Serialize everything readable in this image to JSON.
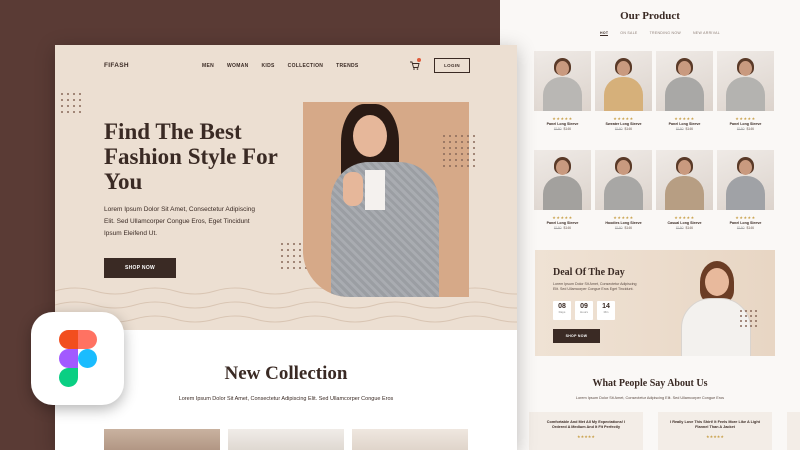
{
  "landing": {
    "brand": "FIFASH",
    "nav": [
      "MEN",
      "WOMAN",
      "KIDS",
      "COLLECTION",
      "TRENDS"
    ],
    "login_label": "LOGIN",
    "hero_title": "Find The Best Fashion Style For You",
    "hero_text": "Lorem Ipsum Dolor Sit Amet, Consectetur Adipiscing Elit. Sed Ullamcorper Congue Eros, Eget Tincidunt Ipsum Eleifend Ut.",
    "shop_label": "SHOP NOW",
    "new_collection_title": "New Collection",
    "new_collection_text": "Lorem Ipsum Dolor Sit Amet, Consectetur Adipiscing Elit. Sed Ullamcorper Congue Eros"
  },
  "products_page": {
    "title": "Our Product",
    "tabs": [
      "HOT",
      "ON SALE",
      "TRENDING NOW",
      "NEW ARRIVAL"
    ],
    "active_tab": "HOT",
    "products": [
      {
        "name": "Panel Long Sleeve",
        "price": "$146",
        "old_price": "$180",
        "stars": "★★★★★",
        "top": "#b9b7b4"
      },
      {
        "name": "Sweater Long Sleeve",
        "price": "$146",
        "old_price": "$180",
        "stars": "★★★★★",
        "top": "#d6b07a"
      },
      {
        "name": "Panel Long Sleeve",
        "price": "$146",
        "old_price": "$180",
        "stars": "★★★★★",
        "top": "#a9a8a6"
      },
      {
        "name": "Panel Long Sleeve",
        "price": "$146",
        "old_price": "$180",
        "stars": "★★★★★",
        "top": "#b4b3b0"
      },
      {
        "name": "Panel Long Sleeve",
        "price": "$146",
        "old_price": "$180",
        "stars": "★★★★★",
        "top": "#a3a19e"
      },
      {
        "name": "Hoodies Long Sleeve",
        "price": "$146",
        "old_price": "$180",
        "stars": "★★★★★",
        "top": "#a8a7a5"
      },
      {
        "name": "Casual Long Sleeve",
        "price": "$146",
        "old_price": "$180",
        "stars": "★★★★★",
        "top": "#b79e83"
      },
      {
        "name": "Panel Long Sleeve",
        "price": "$146",
        "old_price": "$180",
        "stars": "★★★★★",
        "top": "#a0a2a6"
      }
    ],
    "deal": {
      "title": "Deal Of The Day",
      "text": "Lorem Ipsum Dolor Sit Amet, Consectetur Adipiscing Elit. Sed Ullamcorper Congue Eros Eget Tincidunt.",
      "timer": [
        {
          "value": "08",
          "label": "Days"
        },
        {
          "value": "09",
          "label": "Hours"
        },
        {
          "value": "14",
          "label": "Min"
        }
      ],
      "button": "SHOP NOW"
    },
    "testimonials_title": "What People Say About Us",
    "testimonials_text": "Lorem Ipsum Dolor Sit Amet, Consectetur Adipiscing Elit. Sed Ullamcorper Congue Eros",
    "testimonials": [
      {
        "quote": "Comfortable And Met All My Expectations! I Ordered A Medium And It Fit Perfectly",
        "stars": "★★★★★"
      },
      {
        "quote": "I Really Love This Shirt! It Feels More Like A Light Flannel Than A Jacket",
        "stars": "★★★★★"
      }
    ]
  },
  "colors": {
    "background": "#5a3b35",
    "hero": "#ecdfd2",
    "dark": "#3a2a24",
    "accent_star": "#c9a14b"
  },
  "icons": [
    "cart-icon",
    "figma-logo-icon"
  ]
}
